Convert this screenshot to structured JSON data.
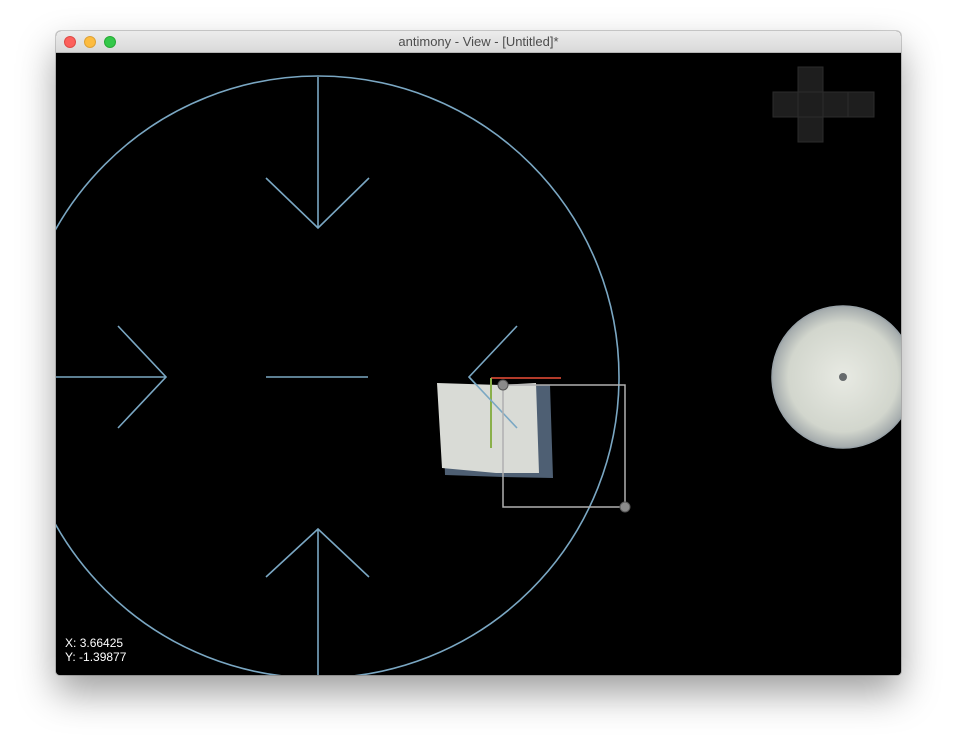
{
  "window": {
    "title": "antimony - View - [Untitled]*"
  },
  "colors": {
    "viewport_background": "#000000",
    "control_handle": "#7aa7c3",
    "shape_face": "#d9dbd6",
    "shape_shadow": "#4e5f73",
    "x_axis": "#b33b2a",
    "y_axis": "#8ab04a",
    "bounding_box": "#b0b0b0",
    "orientation_cube": "#1e1e1e",
    "rotation_sphere": "#d8dbd3"
  },
  "icons": {
    "orientation_cube": "orientation-cross-icon",
    "rotation_sphere": "view-sphere-icon"
  },
  "status": {
    "x_label": "X:",
    "x_value": "3.66425",
    "y_label": "Y:",
    "y_value": "-1.39877"
  }
}
